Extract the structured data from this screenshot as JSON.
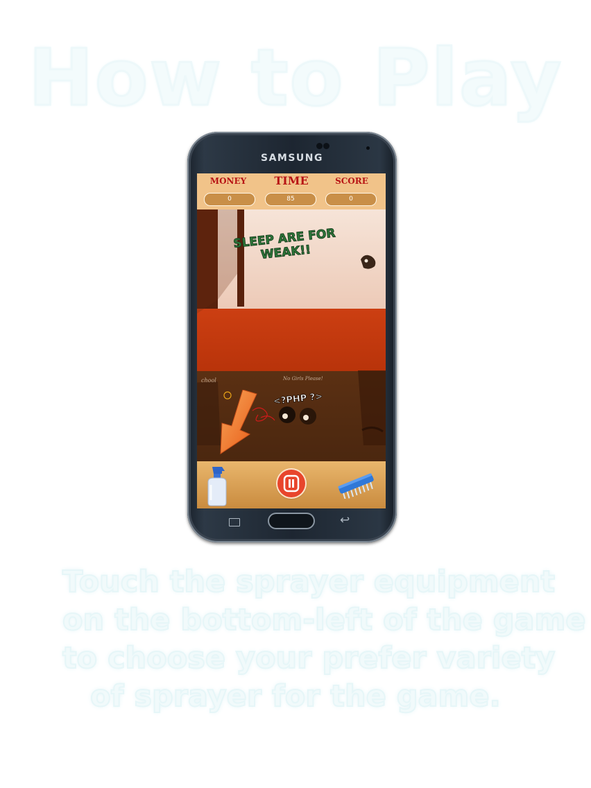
{
  "page": {
    "title": "How to Play",
    "instructions": [
      "Touch the sprayer equipment",
      "on the bottom-left of the game",
      "to choose your prefer  variety",
      "of sprayer for the game."
    ]
  },
  "phone": {
    "brand": "SAMSUNG"
  },
  "game": {
    "hud": {
      "money_label": "MONEY",
      "time_label": "TIME",
      "score_label": "SCORE",
      "money_value": "0",
      "time_value": "85",
      "score_value": "0"
    },
    "wall_graffiti": [
      "SLEEP ARE FOR",
      "WEAK!!"
    ],
    "desk_scrawl": "<?PHP ?>",
    "desk_scrawl_notes": [
      "chool",
      "No Girls Please!"
    ],
    "toolbar": {
      "left_tool_icon": "sprayer-bottle-icon",
      "center_button_icon": "pause-icon",
      "right_tool_icon": "scrub-brush-icon"
    },
    "hint_arrow_icon": "arrow-down-left-icon",
    "colors": {
      "hud_background": "#f1c389",
      "hud_label": "#b81515",
      "floor": "#cc3f12",
      "pause_button": "#e8452c",
      "arrow": "#f07a28"
    }
  }
}
